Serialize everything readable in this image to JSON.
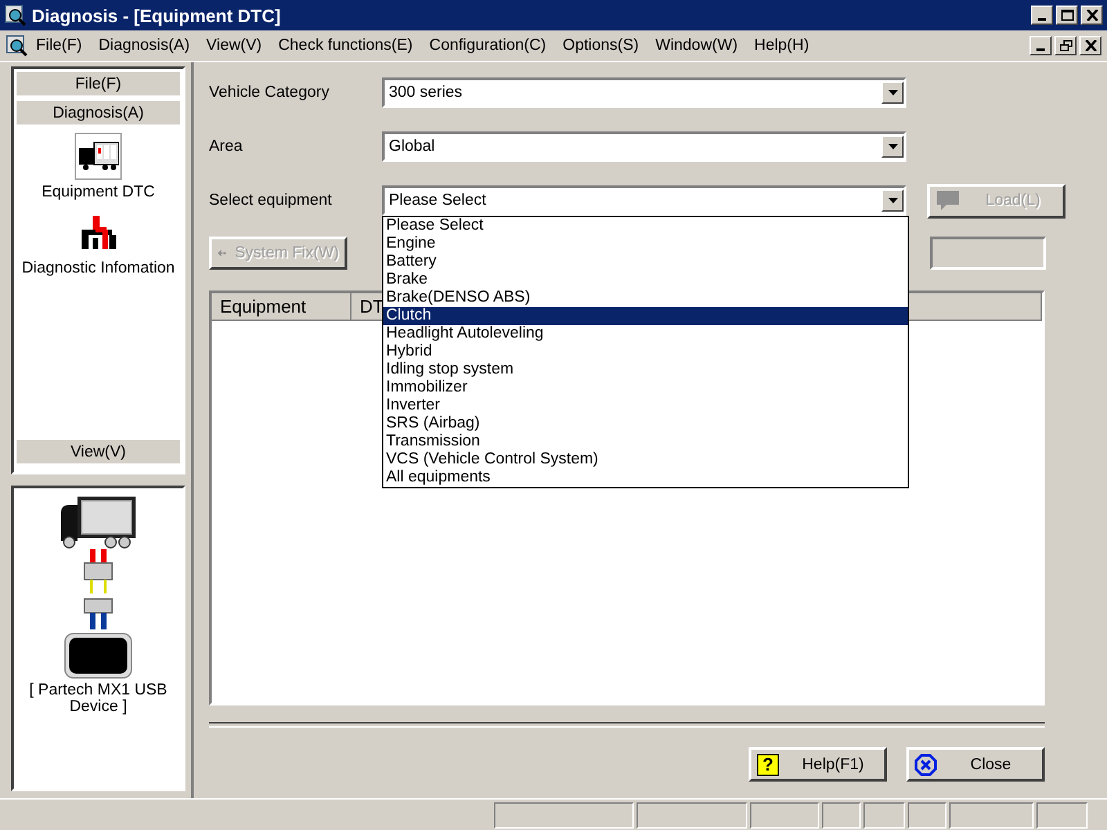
{
  "window": {
    "title": "Diagnosis - [Equipment DTC]"
  },
  "menu": [
    "File(F)",
    "Diagnosis(A)",
    "View(V)",
    "Check functions(E)",
    "Configuration(C)",
    "Options(S)",
    "Window(W)",
    "Help(H)"
  ],
  "sidebar": {
    "top_sections": [
      "File(F)",
      "Diagnosis(A)"
    ],
    "items": [
      {
        "label": "Equipment DTC",
        "kind": "dtc",
        "selected": true
      },
      {
        "label": "Diagnostic Infomation",
        "kind": "info",
        "selected": false
      }
    ],
    "bottom_sections": [
      "View(V)"
    ]
  },
  "device": {
    "label": "[ Partech MX1 USB Device ]"
  },
  "fields": [
    {
      "label": "Vehicle Category",
      "value": "300 series",
      "open": false
    },
    {
      "label": "Area",
      "value": "Global",
      "open": false
    },
    {
      "label": "Select equipment",
      "value": "Please Select",
      "open": true
    }
  ],
  "dropdown_options": [
    {
      "label": "Please Select",
      "selected": false
    },
    {
      "label": "Engine",
      "selected": false
    },
    {
      "label": "Battery",
      "selected": false
    },
    {
      "label": "Brake",
      "selected": false
    },
    {
      "label": "Brake(DENSO ABS)",
      "selected": false
    },
    {
      "label": "Clutch",
      "selected": true
    },
    {
      "label": "Headlight Autoleveling",
      "selected": false
    },
    {
      "label": "Hybrid",
      "selected": false
    },
    {
      "label": "Idling stop system",
      "selected": false
    },
    {
      "label": "Immobilizer",
      "selected": false
    },
    {
      "label": "Inverter",
      "selected": false
    },
    {
      "label": "SRS (Airbag)",
      "selected": false
    },
    {
      "label": "Transmission",
      "selected": false
    },
    {
      "label": "VCS (Vehicle Control System)",
      "selected": false
    },
    {
      "label": "All equipments",
      "selected": false
    }
  ],
  "load_button": {
    "label": "Load(L)",
    "disabled": true
  },
  "system_fix_button": {
    "label": "System Fix(W)",
    "disabled": true
  },
  "table": {
    "columns": [
      "Equipment",
      "DT"
    ]
  },
  "footer_buttons": [
    {
      "label": "Help(F1)",
      "kind": "help",
      "icon": "?"
    },
    {
      "label": "Close",
      "kind": "close"
    }
  ]
}
